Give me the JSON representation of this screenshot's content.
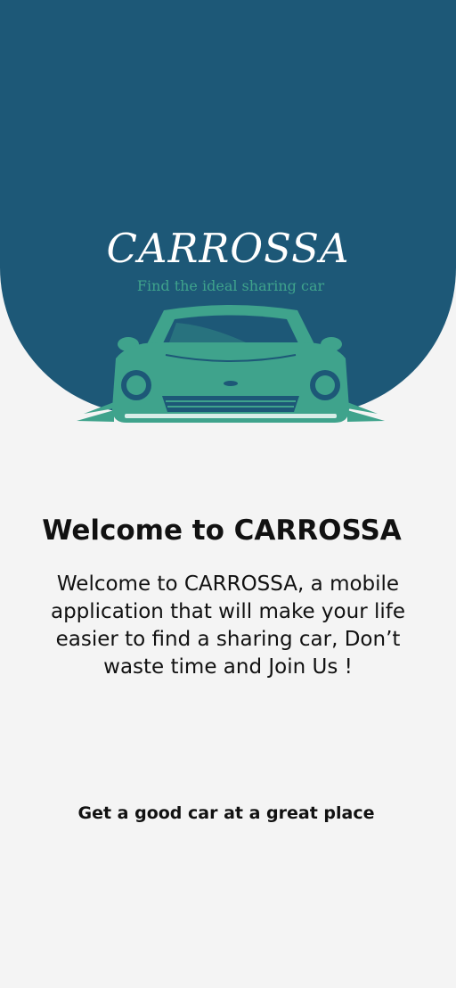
{
  "colors": {
    "hero_background": "#1d5877",
    "brand_accent": "#3fa38c",
    "page_background": "#f4f4f4",
    "text_primary": "#111111"
  },
  "hero": {
    "brand_name": "CARROSSA",
    "tagline": "Find the ideal sharing car",
    "illustration": "car-icon"
  },
  "welcome": {
    "heading": "Welcome to CARROSSA",
    "body": "Welcome to CARROSSA, a mobile application that will make your life easier to find a sharing car, Don’t waste time and Join Us !"
  },
  "footer": {
    "tagline": "Get a good car at a great place"
  }
}
